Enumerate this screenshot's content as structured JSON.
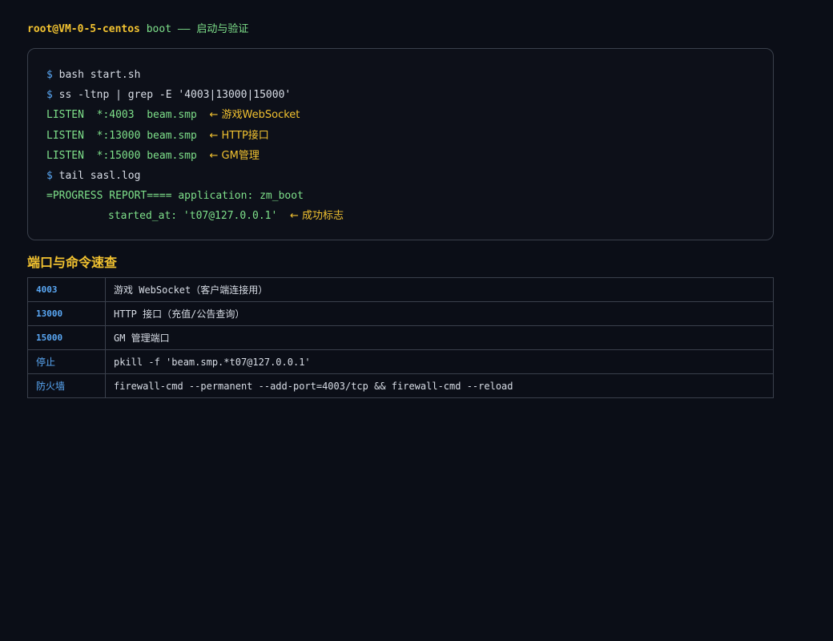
{
  "header": {
    "user_host": "root@VM-0-5-centos",
    "title_rest": " boot —— 启动与验证"
  },
  "terminal": {
    "prompt_symbol": "$",
    "lines": [
      {
        "cmd": " bash start.sh"
      },
      {
        "cmd": " ss -ltnp | grep -E '4003|13000|15000'"
      },
      {
        "out": "LISTEN  *:4003  beam.smp  ",
        "note": "← 游戏WebSocket"
      },
      {
        "out": "LISTEN  *:13000 beam.smp  ",
        "note": "← HTTP接口"
      },
      {
        "out": "LISTEN  *:15000 beam.smp  ",
        "note": "← GM管理"
      },
      {
        "cmd": " tail sasl.log"
      },
      {
        "out": "=PROGRESS REPORT==== application: zm_boot"
      },
      {
        "out": "started_at: 't07@127.0.0.1'  ",
        "note": "← 成功标志"
      }
    ]
  },
  "section": {
    "title": "端口与命令速查"
  },
  "table": {
    "rows": [
      {
        "key": "4003",
        "value": "游戏 WebSocket（客户端连接用）"
      },
      {
        "key": "13000",
        "value": "HTTP 接口（充值/公告查询）"
      },
      {
        "key": "15000",
        "value": "GM 管理端口"
      },
      {
        "key": "停止",
        "value": "pkill -f 'beam.smp.*t07@127.0.0.1'"
      },
      {
        "key": "防火墙",
        "value": "firewall-cmd --permanent --add-port=4003/tcp && firewall-cmd --reload"
      }
    ]
  },
  "colors": {
    "background": "#0b0e17",
    "accent_yellow": "#f2c230",
    "accent_green": "#7ee08a",
    "accent_blue": "#5aa8f5",
    "border": "#3a404c"
  }
}
